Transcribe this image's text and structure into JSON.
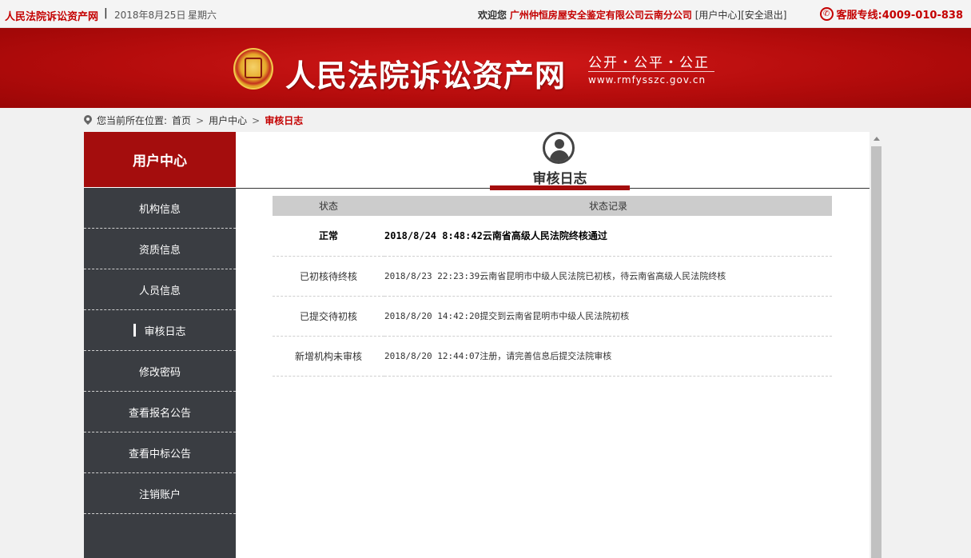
{
  "topbar": {
    "site_name": "人民法院诉讼资产网",
    "separator": "|",
    "date": "2018年8月25日",
    "weekday": "星期六",
    "welcome_label": "欢迎您",
    "org_name": "广州仲恒房屋安全鉴定有限公司云南分公司",
    "user_center_link": "[用户中心]",
    "logout_link": "[安全退出]",
    "hotline": "客服专线:4009-010-838"
  },
  "banner": {
    "brand": "人民法院诉讼资产网",
    "slogan": "公开・公平・公正",
    "domain": "www.rmfysszc.gov.cn"
  },
  "breadcrumb": {
    "prefix": "您当前所在位置:",
    "items": [
      "首页",
      "用户中心"
    ],
    "arrow": ">",
    "current": "审核日志"
  },
  "sidebar": {
    "title": "用户中心",
    "items": [
      {
        "label": "机构信息"
      },
      {
        "label": "资质信息"
      },
      {
        "label": "人员信息"
      },
      {
        "label": "审核日志",
        "active": true
      },
      {
        "label": "修改密码"
      },
      {
        "label": "查看报名公告"
      },
      {
        "label": "查看中标公告"
      },
      {
        "label": "注销账户"
      }
    ]
  },
  "main": {
    "title": "审核日志",
    "columns": [
      "状态",
      "状态记录"
    ],
    "rows": [
      {
        "status": "正常",
        "record": "2018/8/24 8:48:42云南省高级人民法院终核通过"
      },
      {
        "status": "已初核待终核",
        "record": "2018/8/23 22:23:39云南省昆明市中级人民法院已初核，待云南省高级人民法院终核"
      },
      {
        "status": "已提交待初核",
        "record": "2018/8/20 14:42:20提交到云南省昆明市中级人民法院初核"
      },
      {
        "status": "新增机构未审核",
        "record": "2018/8/20 12:44:07注册，请完善信息后提交法院审核"
      }
    ]
  },
  "colors": {
    "brand_red": "#c40000",
    "sidebar_head": "#a40d0d",
    "sidebar_bg": "#3a3d42"
  },
  "icons": [
    "phone-icon",
    "court-emblem-icon",
    "location-pin-icon",
    "user-avatar-icon"
  ]
}
